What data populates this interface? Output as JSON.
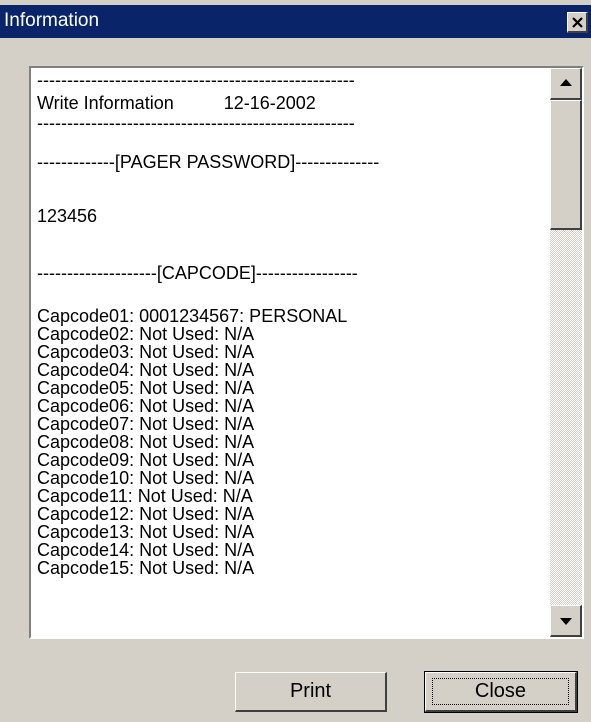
{
  "window": {
    "title": "Information"
  },
  "info": {
    "lines": [
      "-----------------------------------------------------",
      "Write Information          12-16-2002",
      "-----------------------------------------------------",
      "",
      "-------------[PAGER PASSWORD]--------------",
      "",
      "123456",
      "",
      "",
      "--------------------[CAPCODE]-----------------",
      "",
      "Capcode01: 0001234567: PERSONAL",
      "Capcode02: Not Used: N/A",
      "Capcode03: Not Used: N/A",
      "Capcode04: Not Used: N/A",
      "Capcode05: Not Used: N/A",
      "Capcode06: Not Used: N/A",
      "Capcode07: Not Used: N/A",
      "Capcode08: Not Used: N/A",
      "Capcode09: Not Used: N/A",
      "Capcode10: Not Used: N/A",
      "Capcode11: Not Used: N/A",
      "Capcode12: Not Used: N/A",
      "Capcode13: Not Used: N/A",
      "Capcode14: Not Used: N/A",
      "Capcode15: Not Used: N/A"
    ]
  },
  "buttons": {
    "print_label": "Print",
    "close_label": "Close"
  },
  "colors": {
    "titlebar": "#0a246a",
    "face": "#d4d0c8"
  },
  "icons": {
    "close": "close-x-icon",
    "scroll_up": "arrow-up-icon",
    "scroll_down": "arrow-down-icon"
  }
}
